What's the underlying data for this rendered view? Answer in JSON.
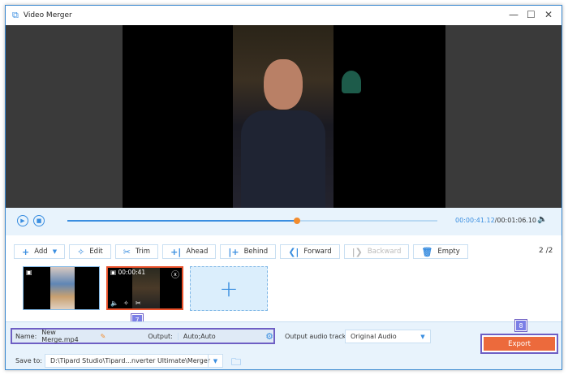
{
  "window": {
    "title": "Video Merger",
    "minimize_icon": "minimize-icon",
    "maximize_icon": "maximize-icon",
    "close_icon": "close-icon"
  },
  "player": {
    "current_time": "00:00:41.12",
    "total_time": "/00:01:06.10",
    "progress_fraction": 0.62
  },
  "toolbar": {
    "add": "Add",
    "edit": "Edit",
    "trim": "Trim",
    "ahead": "Ahead",
    "behind": "Behind",
    "forward": "Forward",
    "backward": "Backward",
    "empty": "Empty",
    "page": "2 /2"
  },
  "clips": [
    {
      "duration": ""
    },
    {
      "duration": "00:00:41"
    }
  ],
  "bottom": {
    "name_label": "Name:",
    "name_value": "New Merge.mp4",
    "output_label": "Output:",
    "output_value": "Auto;Auto",
    "audio_label": "Output audio track:",
    "audio_value": "Original Audio",
    "save_label": "Save to:",
    "save_path": "D:\\Tipard Studio\\Tipard...nverter Ultimate\\Merger",
    "export": "Export",
    "badge7": "7",
    "badge8": "8"
  },
  "colors": {
    "accent": "#3a8ee0",
    "export": "#ec6a3c",
    "highlight": "#6e5fc4"
  }
}
